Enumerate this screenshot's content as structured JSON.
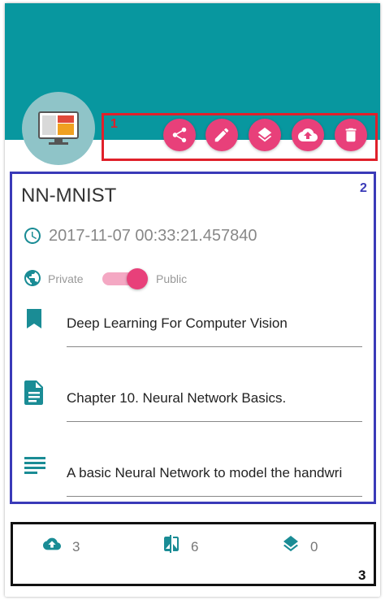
{
  "colors": {
    "header": "#08979f",
    "accent": "#e8407a",
    "teal_icon": "#1a8c95",
    "annotation_red": "#e0202a",
    "annotation_blue": "#3a3ab8",
    "annotation_black": "#111111"
  },
  "annotations": {
    "actions_number": "1",
    "details_number": "2",
    "stats_number": "3"
  },
  "header": {
    "avatar_icon": "desktop-monitor-icon"
  },
  "actions": [
    {
      "name": "share-button",
      "icon": "share-icon"
    },
    {
      "name": "edit-button",
      "icon": "pencil-icon"
    },
    {
      "name": "layers-button",
      "icon": "layers-icon"
    },
    {
      "name": "upload-button",
      "icon": "cloud-upload-icon"
    },
    {
      "name": "delete-button",
      "icon": "trash-icon"
    }
  ],
  "details": {
    "title": "NN-MNIST",
    "timestamp": "2017-11-07 00:33:21.457840",
    "visibility": {
      "private_label": "Private",
      "public_label": "Public",
      "is_public": true
    },
    "fields": [
      {
        "icon": "bookmark-icon",
        "value": "Deep Learning For Computer Vision"
      },
      {
        "icon": "document-icon",
        "value": "Chapter 10. Neural Network Basics."
      },
      {
        "icon": "notes-icon",
        "value": "A basic Neural Network to model the handwri"
      }
    ]
  },
  "stats": [
    {
      "icon": "cloud-upload-icon",
      "value": "3"
    },
    {
      "icon": "compare-icon",
      "value": "6"
    },
    {
      "icon": "layers-icon",
      "value": "0"
    }
  ]
}
